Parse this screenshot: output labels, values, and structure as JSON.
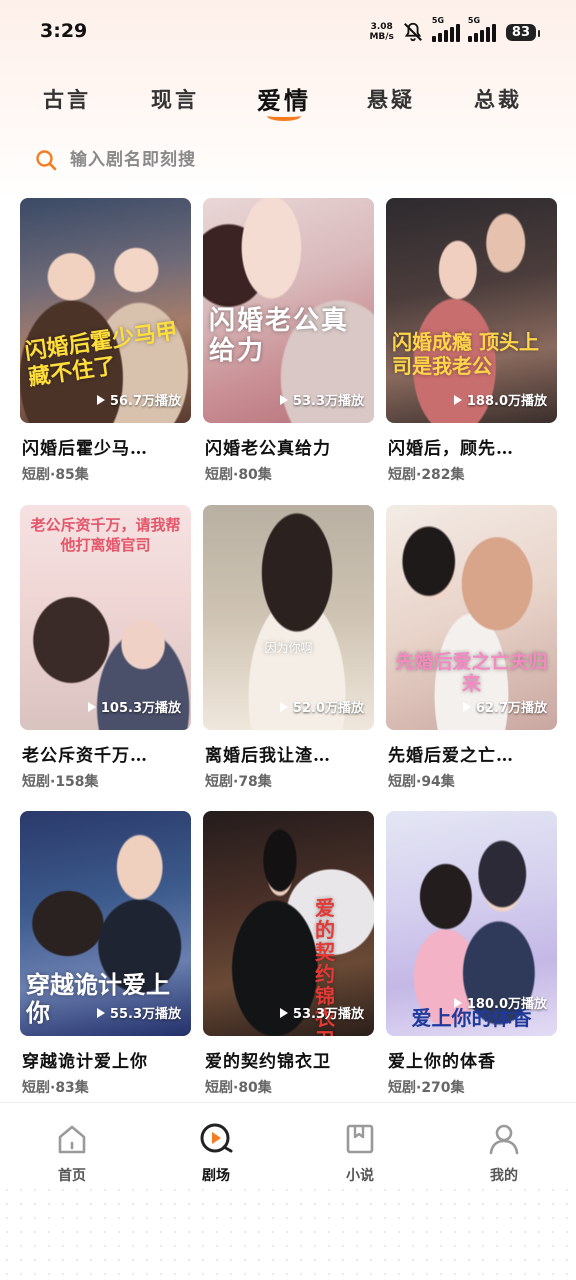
{
  "status_bar": {
    "time": "3:29",
    "net_speed_value": "3.08",
    "net_speed_unit": "MB/s",
    "sim1_label": "5G",
    "sim2_label": "5G",
    "battery": "83"
  },
  "tabs": [
    {
      "label": "古言",
      "active": false
    },
    {
      "label": "现言",
      "active": false
    },
    {
      "label": "爱情",
      "active": true
    },
    {
      "label": "悬疑",
      "active": false
    },
    {
      "label": "总裁",
      "active": false
    }
  ],
  "search": {
    "placeholder": "输入剧名即刻搜",
    "icon": "search-icon"
  },
  "dramas": [
    {
      "title": "闪婚后霍少马…",
      "meta": "短剧·85集",
      "plays": "56.7万播放",
      "poster_text": "闪婚后霍少马甲藏不住了"
    },
    {
      "title": "闪婚老公真给力",
      "meta": "短剧·80集",
      "plays": "53.3万播放",
      "poster_text": "闪婚老公真给力"
    },
    {
      "title": "闪婚后，顾先…",
      "meta": "短剧·282集",
      "plays": "188.0万播放",
      "poster_text": "闪婚成瘾 顶头上司是我老公"
    },
    {
      "title": "老公斥资千万…",
      "meta": "短剧·158集",
      "plays": "105.3万播放",
      "poster_text": "老公斥资千万，请我帮他打离婚官司"
    },
    {
      "title": "离婚后我让渣…",
      "meta": "短剧·78集",
      "plays": "52.0万播放",
      "poster_text": "因为你啊"
    },
    {
      "title": "先婚后爱之亡…",
      "meta": "短剧·94集",
      "plays": "62.7万播放",
      "poster_text": "先婚后爱之亡夫归来"
    },
    {
      "title": "穿越诡计爱上你",
      "meta": "短剧·83集",
      "plays": "55.3万播放",
      "poster_text": "穿越诡计爱上你"
    },
    {
      "title": "爱的契约锦衣卫",
      "meta": "短剧·80集",
      "plays": "53.3万播放",
      "poster_text": "爱的契约锦衣卫"
    },
    {
      "title": "爱上你的体香",
      "meta": "短剧·270集",
      "plays": "180.0万播放",
      "poster_text": "爱上你的体香"
    }
  ],
  "bottom_nav": [
    {
      "label": "首页",
      "icon": "home-icon",
      "active": false
    },
    {
      "label": "剧场",
      "icon": "theater-play-icon",
      "active": true
    },
    {
      "label": "小说",
      "icon": "book-icon",
      "active": false
    },
    {
      "label": "我的",
      "icon": "profile-icon",
      "active": false
    }
  ],
  "colors": {
    "accent": "#f57c1f",
    "text_primary": "#111111",
    "text_secondary": "#666666"
  }
}
